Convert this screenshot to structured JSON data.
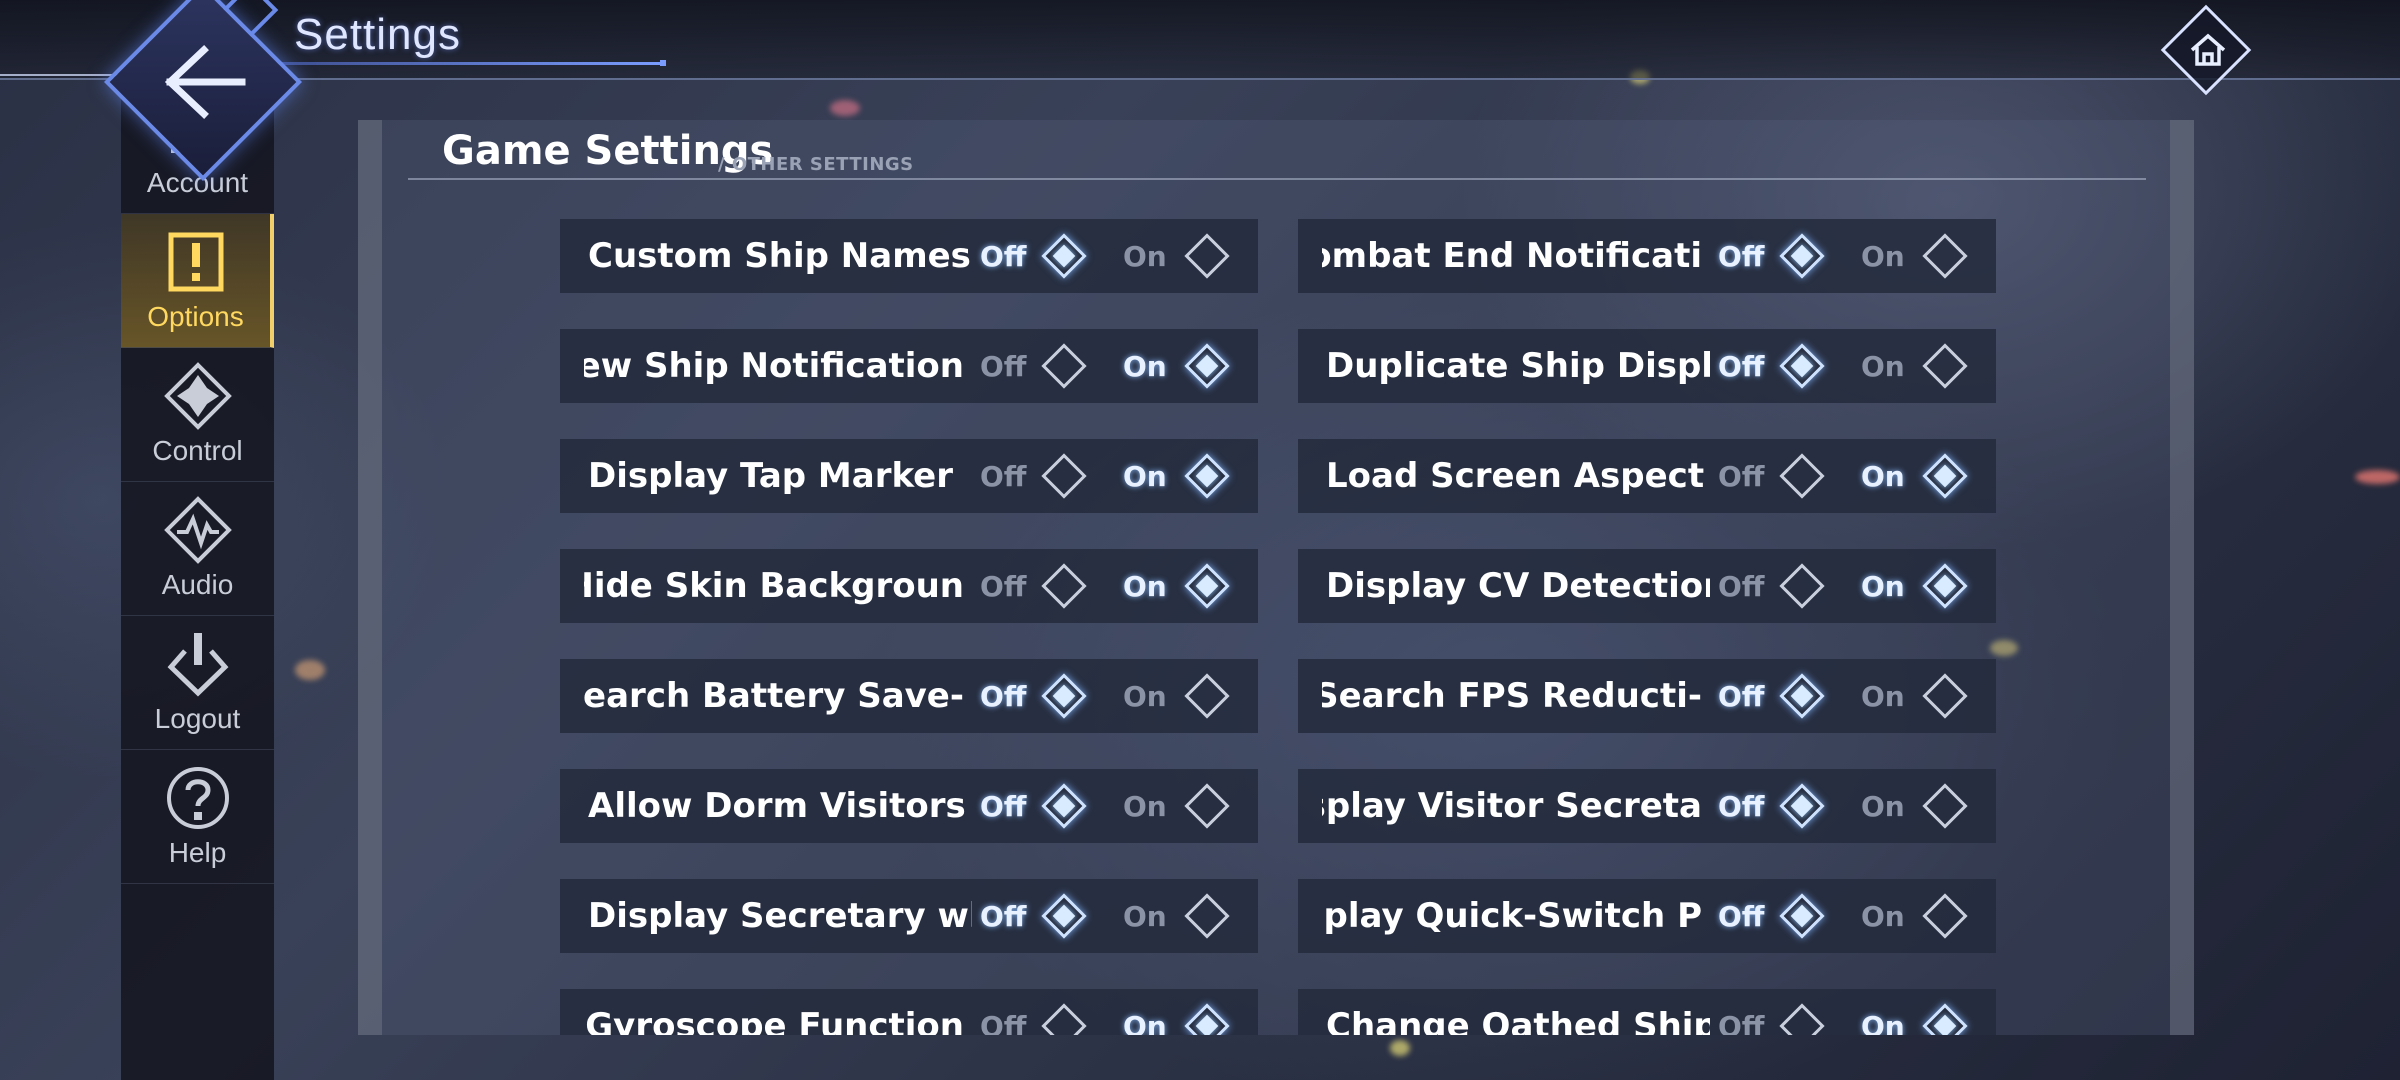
{
  "header": {
    "title": "Settings"
  },
  "sidebar": {
    "items": [
      {
        "label": "Account",
        "icon": "account-icon"
      },
      {
        "label": "Options",
        "icon": "options-icon",
        "active": true
      },
      {
        "label": "Control",
        "icon": "control-icon"
      },
      {
        "label": "Audio",
        "icon": "audio-icon"
      },
      {
        "label": "Logout",
        "icon": "power-icon"
      },
      {
        "label": "Help",
        "icon": "help-icon"
      }
    ]
  },
  "panel": {
    "title": "Game Settings",
    "subtitle": "/ OTHER SETTINGS",
    "off_label": "Off",
    "on_label": "On",
    "settings": [
      {
        "name": "Custom Ship Names",
        "value": "Off"
      },
      {
        "name": "ombat End Notificati",
        "value": "Off"
      },
      {
        "name": "ew Ship Notification",
        "value": "On"
      },
      {
        "name": "Duplicate Ship Displa",
        "value": "Off"
      },
      {
        "name": "Display Tap Marker",
        "value": "On"
      },
      {
        "name": "Load Screen Aspect R",
        "value": "On"
      },
      {
        "name": "Hide Skin Backgroun",
        "value": "On"
      },
      {
        "name": "Display CV Detection",
        "value": "On"
      },
      {
        "name": "-Search Battery Save",
        "value": "Off"
      },
      {
        "name": "-Search FPS Reducti",
        "value": "Off"
      },
      {
        "name": "Allow Dorm Visitors",
        "value": "Off"
      },
      {
        "name": "isplay Visitor Secreta",
        "value": "Off"
      },
      {
        "name": "Display Secretary wh",
        "value": "Off"
      },
      {
        "name": "splay Quick-Switch P",
        "value": "Off"
      },
      {
        "name": "Gyroscope Function",
        "value": "On"
      },
      {
        "name": "Change Oathed Ship",
        "value": "On"
      }
    ]
  },
  "colors": {
    "accent": "#6b8ae8",
    "active_tab": "#ffd860"
  }
}
